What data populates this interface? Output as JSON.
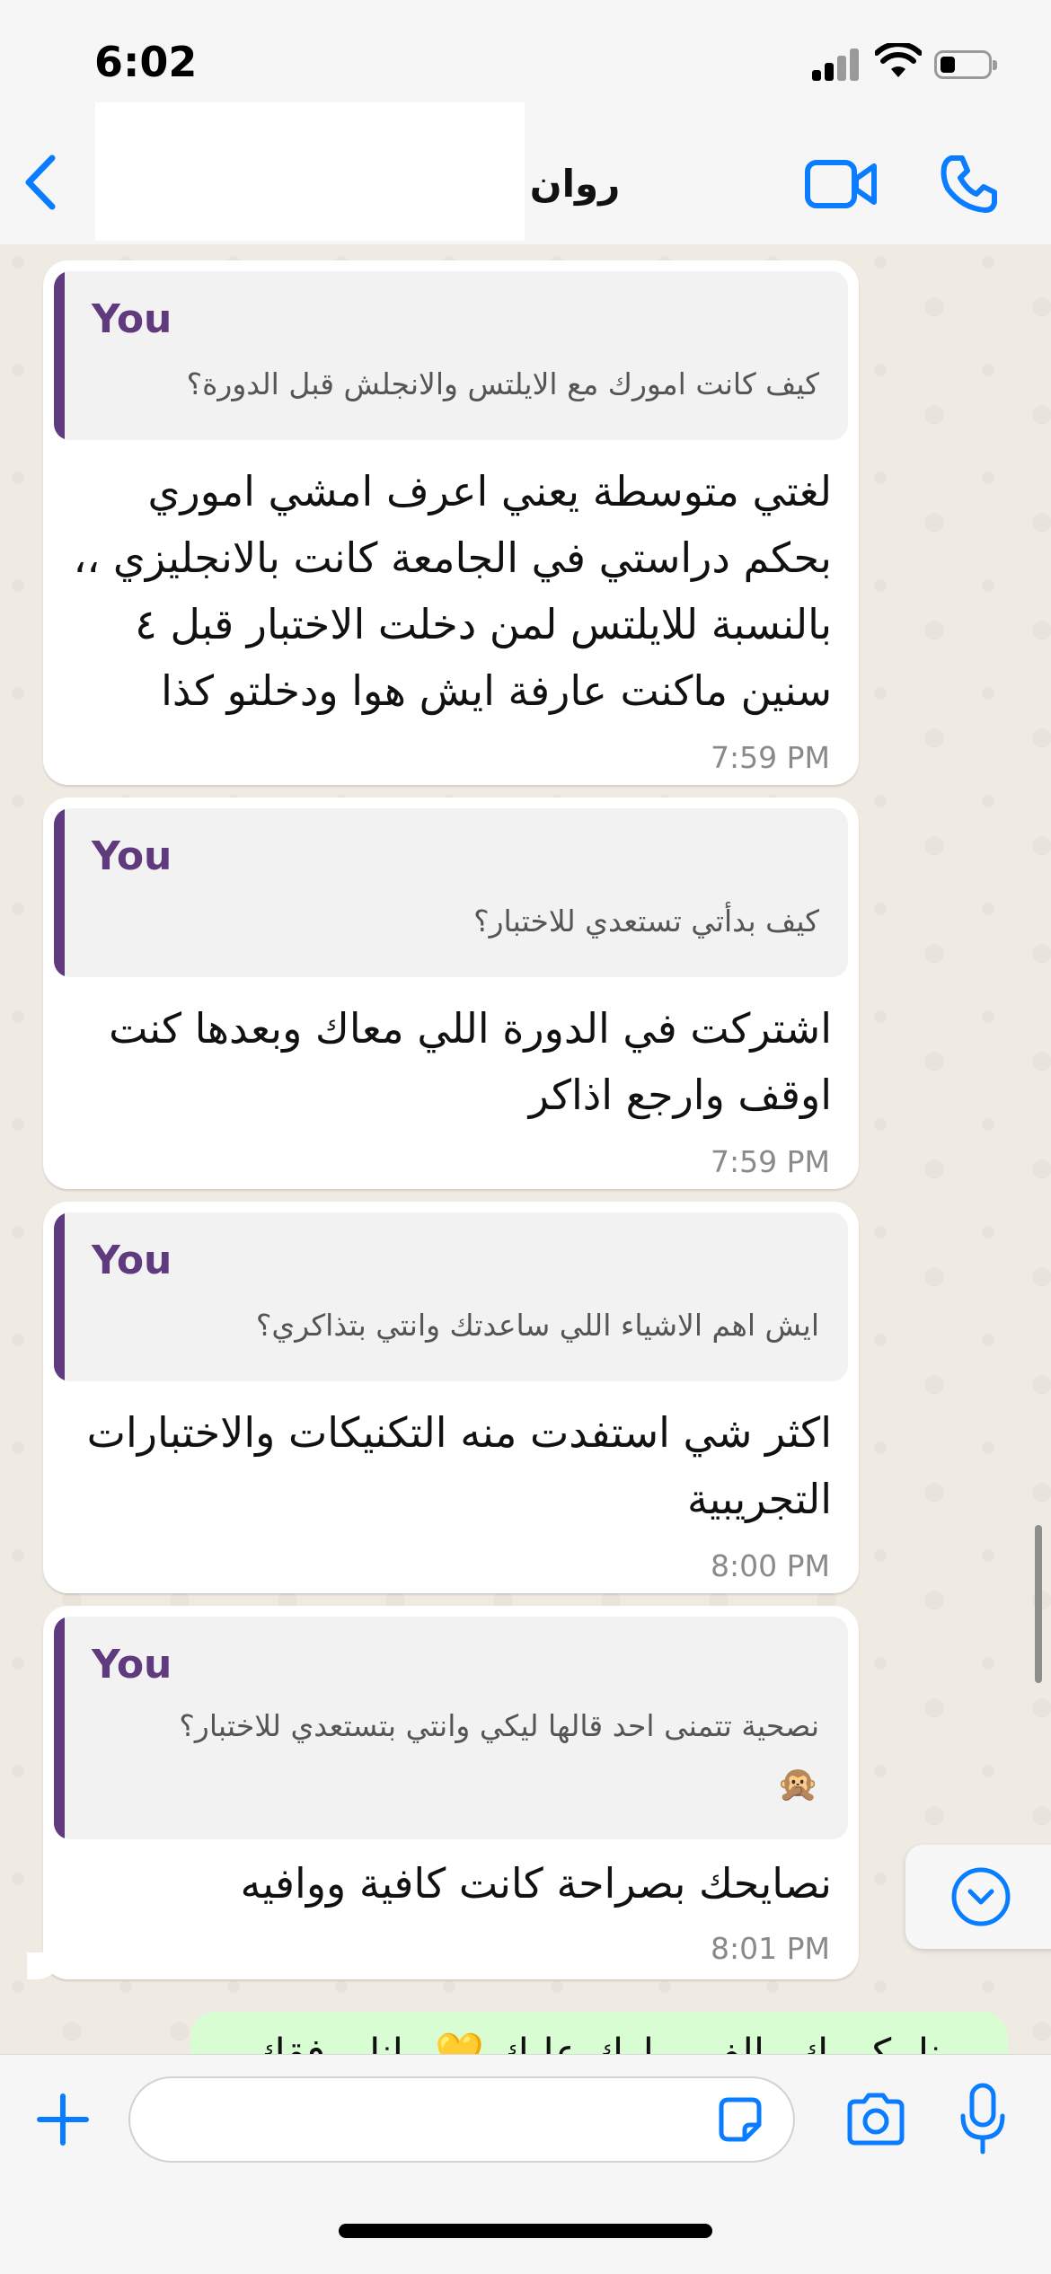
{
  "status_bar": {
    "time": "6:02"
  },
  "header": {
    "contact_name": "روان"
  },
  "messages": [
    {
      "quote_author": "You",
      "quote_text": "كيف كانت امورك مع الايلتس والانجلش قبل الدورة؟",
      "text_lines": [
        "لغتي متوسطة يعني اعرف امشي اموري",
        "بحكم دراستي في الجامعة كانت بالانجليزي ،،",
        "بالنسبة للايلتس لمن دخلت الاختبار قبل ٤",
        "سنين ماكنت عارفة ايش هوا ودخلتو كذا"
      ],
      "time": "7:59 PM"
    },
    {
      "quote_author": "You",
      "quote_text": "كيف بدأتي تستعدي للاختبار؟",
      "text_lines": [
        "اشتركت في الدورة اللي معاك وبعدها كنت",
        "اوقف وارجع اذاكر"
      ],
      "time": "7:59 PM"
    },
    {
      "quote_author": "You",
      "quote_text": "ايش اهم الاشياء اللي ساعدتك وانتي بتذاكري؟",
      "text_lines": [
        "اكثر شي استفدت منه التكنيكات والاختبارات",
        "التجريبية"
      ],
      "time": "8:00 PM"
    },
    {
      "quote_author": "You",
      "quote_text": "نصحية تتمنى احد قالها ليكي وانتي بتستعدي للاختبار؟",
      "quote_emoji": "🙊",
      "text_lines": [
        "نصايحك بصراحة كانت كافية ووافيه"
      ],
      "time": "8:01 PM"
    }
  ],
  "outgoing_partial": {
    "text": "ربنا يكرمك والف مبارك عليك 💛 وانا يوفقك"
  },
  "composer": {
    "placeholder": ""
  },
  "icons": {
    "back": "chevron-left-icon",
    "video": "video-camera-icon",
    "call": "phone-icon",
    "plus": "plus-icon",
    "sticker": "sticker-icon",
    "camera": "camera-icon",
    "mic": "microphone-icon",
    "scroll_down": "chevron-down-circle-icon"
  },
  "colors": {
    "accent": "#0a7cff",
    "quote_bar": "#5f3a7d",
    "outgoing_bg": "#d9fdd3"
  }
}
